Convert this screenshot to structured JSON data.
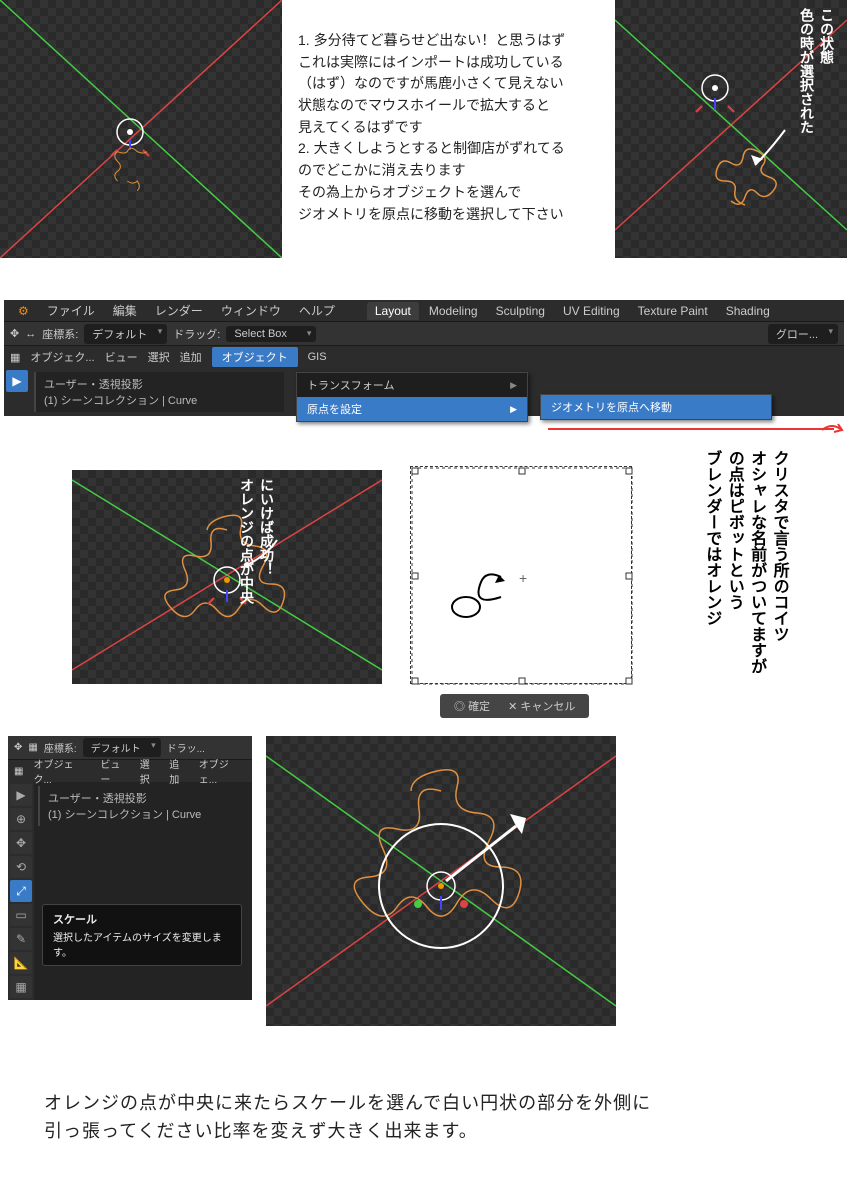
{
  "text_top": "1. 多分待てど暮らせど出ない！と思うはず\nこれは実際にはインポートは成功している\n（はず）なのですが馬鹿小さくて見えない\n状態なのでマウスホイールで拡大すると\n見えてくるはずです\n2. 大きくしようとすると制御店がずれてる\nのでどこかに消え去ります\nその為上からオブジェクトを選んで\nジオメトリを原点に移動を選択して下さい",
  "hand_top_right": "この状態\n色の時が選択された",
  "menubar": {
    "file": "ファイル",
    "edit": "編集",
    "render": "レンダー",
    "window": "ウィンドウ",
    "help": "ヘルプ",
    "layout": "Layout",
    "modeling": "Modeling",
    "sculpting": "Sculpting",
    "uv": "UV Editing",
    "texture": "Texture Paint",
    "shading": "Shading"
  },
  "toolbar": {
    "coord": "座標系:",
    "default": "デフォルト",
    "drag": "ドラッグ:",
    "selectbox": "Select Box",
    "global": "グロー..."
  },
  "sub": {
    "object": "オブジェク...",
    "view": "ビュー",
    "select": "選択",
    "add": "追加",
    "objectbtn": "オブジェクト",
    "gis": "GIS"
  },
  "info": {
    "line1": "ユーザー・透視投影",
    "line2": "(1) シーンコレクション | Curve"
  },
  "drop": {
    "transform": "トランスフォーム",
    "origin": "原点を設定",
    "geom": "ジオメトリを原点へ移動"
  },
  "hand_mid_white": "にいけば成功！\nオレンジの点が中央",
  "hand_right_long": "クリスタで言う所のコイツ\nオシャレな名前がついてますが\nの点はピボットという\nブレンダーではオレンジ",
  "dialog": {
    "ok": "確定",
    "cancel": "キャンセル"
  },
  "panel2": {
    "coord": "座標系:",
    "default": "デフォルト",
    "drag": "ドラッ...",
    "object": "オブジェク...",
    "view": "ビュー",
    "select": "選択",
    "add": "追加",
    "obj2": "オブジェ...",
    "info1": "ユーザー・透視投影",
    "info2": "(1) シーンコレクション | Curve"
  },
  "tooltip": {
    "title": "スケール",
    "desc": "選択したアイテムのサイズを変更します。"
  },
  "bottom_text": "オレンジの点が中央に来たらスケールを選んで白い円状の部分を外側に\n引っ張ってください比率を変えず大きく出来ます。"
}
